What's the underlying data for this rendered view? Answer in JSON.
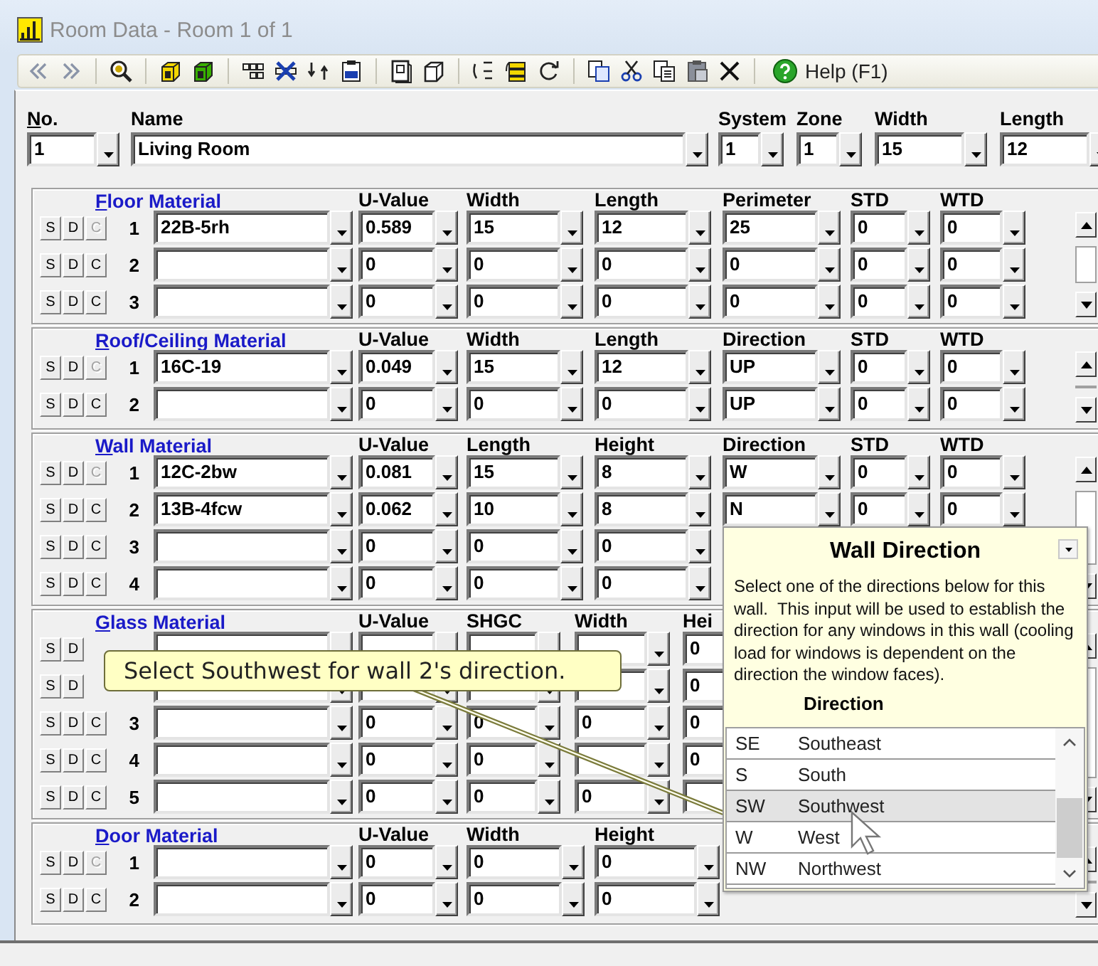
{
  "window": {
    "title": "Room Data - Room 1 of 1"
  },
  "toolbar": {
    "help_label": "Help (F1)"
  },
  "room": {
    "fields": [
      {
        "label": "No.",
        "mnemonic": true,
        "value": "1"
      },
      {
        "label": "Name",
        "mnemonic": false,
        "value": "Living Room"
      },
      {
        "label": "System",
        "mnemonic": false,
        "value": "1"
      },
      {
        "label": "Zone",
        "mnemonic": false,
        "value": "1"
      },
      {
        "label": "Width",
        "mnemonic": false,
        "value": "15"
      },
      {
        "label": "Length",
        "mnemonic": false,
        "value": "12"
      }
    ]
  },
  "sections": [
    {
      "kind": "floor",
      "mnemonic": true,
      "columns": [
        "Floor Material",
        "U-Value",
        "Width",
        "Length",
        "Perimeter",
        "STD",
        "WTD"
      ],
      "rows": [
        {
          "number": "1",
          "buttons": [
            {
              "label": "S",
              "disabled": false
            },
            {
              "label": "D",
              "disabled": false
            },
            {
              "label": "C",
              "disabled": true
            }
          ],
          "cells": [
            "22B-5rh",
            "0.589",
            "15",
            "12",
            "25",
            "0",
            "0"
          ]
        },
        {
          "number": "2",
          "buttons": [
            {
              "label": "S",
              "disabled": false
            },
            {
              "label": "D",
              "disabled": false
            },
            {
              "label": "C",
              "disabled": false
            }
          ],
          "cells": [
            null,
            "0",
            "0",
            "0",
            "0",
            "0",
            "0"
          ]
        },
        {
          "number": "3",
          "buttons": [
            {
              "label": "S",
              "disabled": false
            },
            {
              "label": "D",
              "disabled": false
            },
            {
              "label": "C",
              "disabled": false
            }
          ],
          "cells": [
            null,
            "0",
            "0",
            "0",
            "0",
            "0",
            "0"
          ]
        }
      ]
    },
    {
      "kind": "roof",
      "mnemonic": true,
      "columns": [
        "Roof/Ceiling Material",
        "U-Value",
        "Width",
        "Length",
        "Direction",
        "STD",
        "WTD"
      ],
      "rows": [
        {
          "number": "1",
          "buttons": [
            {
              "label": "S",
              "disabled": false
            },
            {
              "label": "D",
              "disabled": false
            },
            {
              "label": "C",
              "disabled": true
            }
          ],
          "cells": [
            "16C-19",
            "0.049",
            "15",
            "12",
            "UP",
            "0",
            "0"
          ]
        },
        {
          "number": "2",
          "buttons": [
            {
              "label": "S",
              "disabled": false
            },
            {
              "label": "D",
              "disabled": false
            },
            {
              "label": "C",
              "disabled": false
            }
          ],
          "cells": [
            null,
            "0",
            "0",
            "0",
            "UP",
            "0",
            "0"
          ]
        }
      ]
    },
    {
      "kind": "wall",
      "mnemonic": true,
      "columns": [
        "Wall Material",
        "U-Value",
        "Length",
        "Height",
        "Direction",
        "STD",
        "WTD"
      ],
      "rows": [
        {
          "number": "1",
          "buttons": [
            {
              "label": "S",
              "disabled": false
            },
            {
              "label": "D",
              "disabled": false
            },
            {
              "label": "C",
              "disabled": true
            }
          ],
          "cells": [
            "12C-2bw",
            "0.081",
            "15",
            "8",
            "W",
            "0",
            "0"
          ]
        },
        {
          "number": "2",
          "buttons": [
            {
              "label": "S",
              "disabled": false
            },
            {
              "label": "D",
              "disabled": false
            },
            {
              "label": "C",
              "disabled": false
            }
          ],
          "cells": [
            "13B-4fcw",
            "0.062",
            "10",
            "8",
            "N",
            "0",
            "0"
          ]
        },
        {
          "number": "3",
          "buttons": [
            {
              "label": "S",
              "disabled": false
            },
            {
              "label": "D",
              "disabled": false
            },
            {
              "label": "C",
              "disabled": false
            }
          ],
          "cells": [
            null,
            "0",
            "0",
            "0"
          ]
        },
        {
          "number": "4",
          "buttons": [
            {
              "label": "S",
              "disabled": false
            },
            {
              "label": "D",
              "disabled": false
            },
            {
              "label": "C",
              "disabled": false
            }
          ],
          "cells": [
            null,
            "0",
            "0",
            "0"
          ]
        }
      ]
    },
    {
      "kind": "glass",
      "mnemonic": true,
      "columns": [
        "Glass Material",
        "U-Value",
        "SHGC",
        "Width",
        "Hei"
      ],
      "rows": [
        {
          "number": null,
          "buttons": [
            {
              "label": "S",
              "disabled": false
            },
            {
              "label": "D",
              "disabled": false
            }
          ],
          "cells": [
            null,
            null,
            null,
            null,
            "0"
          ]
        },
        {
          "number": null,
          "buttons": [
            {
              "label": "S",
              "disabled": false
            },
            {
              "label": "D",
              "disabled": false
            }
          ],
          "cells": [
            null,
            null,
            null,
            null,
            "0"
          ]
        },
        {
          "number": "3",
          "buttons": [
            {
              "label": "S",
              "disabled": false
            },
            {
              "label": "D",
              "disabled": false
            },
            {
              "label": "C",
              "disabled": false
            }
          ],
          "cells": [
            null,
            "0",
            "0",
            "0",
            "0"
          ]
        },
        {
          "number": "4",
          "buttons": [
            {
              "label": "S",
              "disabled": false
            },
            {
              "label": "D",
              "disabled": false
            },
            {
              "label": "C",
              "disabled": false
            }
          ],
          "cells": [
            null,
            "0",
            "0",
            null,
            "0"
          ]
        },
        {
          "number": "5",
          "buttons": [
            {
              "label": "S",
              "disabled": false
            },
            {
              "label": "D",
              "disabled": false
            },
            {
              "label": "C",
              "disabled": false
            }
          ],
          "cells": [
            null,
            "0",
            "0",
            "0",
            null
          ]
        }
      ]
    },
    {
      "kind": "door",
      "mnemonic": true,
      "columns": [
        "Door Material",
        "U-Value",
        "Width",
        "Height"
      ],
      "rows": [
        {
          "number": "1",
          "buttons": [
            {
              "label": "S",
              "disabled": false
            },
            {
              "label": "D",
              "disabled": false
            },
            {
              "label": "C",
              "disabled": true
            }
          ],
          "cells": [
            null,
            "0",
            "0",
            "0"
          ]
        },
        {
          "number": "2",
          "buttons": [
            {
              "label": "S",
              "disabled": false
            },
            {
              "label": "D",
              "disabled": false
            },
            {
              "label": "C",
              "disabled": false
            }
          ],
          "cells": [
            null,
            "0",
            "0",
            "0"
          ]
        }
      ]
    }
  ],
  "direction_popup": {
    "title": "Wall Direction",
    "description": "Select one of the directions below for this wall.  This input will be used to establish the direction for any windows in this wall (cooling load for windows is dependent on the direction the window faces).",
    "column_header": "Direction",
    "options": [
      {
        "code": "SE",
        "name": "Southeast",
        "selected": false
      },
      {
        "code": "S",
        "name": "South",
        "selected": false
      },
      {
        "code": "SW",
        "name": "Southwest",
        "selected": true
      },
      {
        "code": "W",
        "name": "West",
        "selected": false
      },
      {
        "code": "NW",
        "name": "Northwest",
        "selected": false
      }
    ]
  },
  "callout": {
    "text": "Select Southwest for wall 2's direction."
  }
}
